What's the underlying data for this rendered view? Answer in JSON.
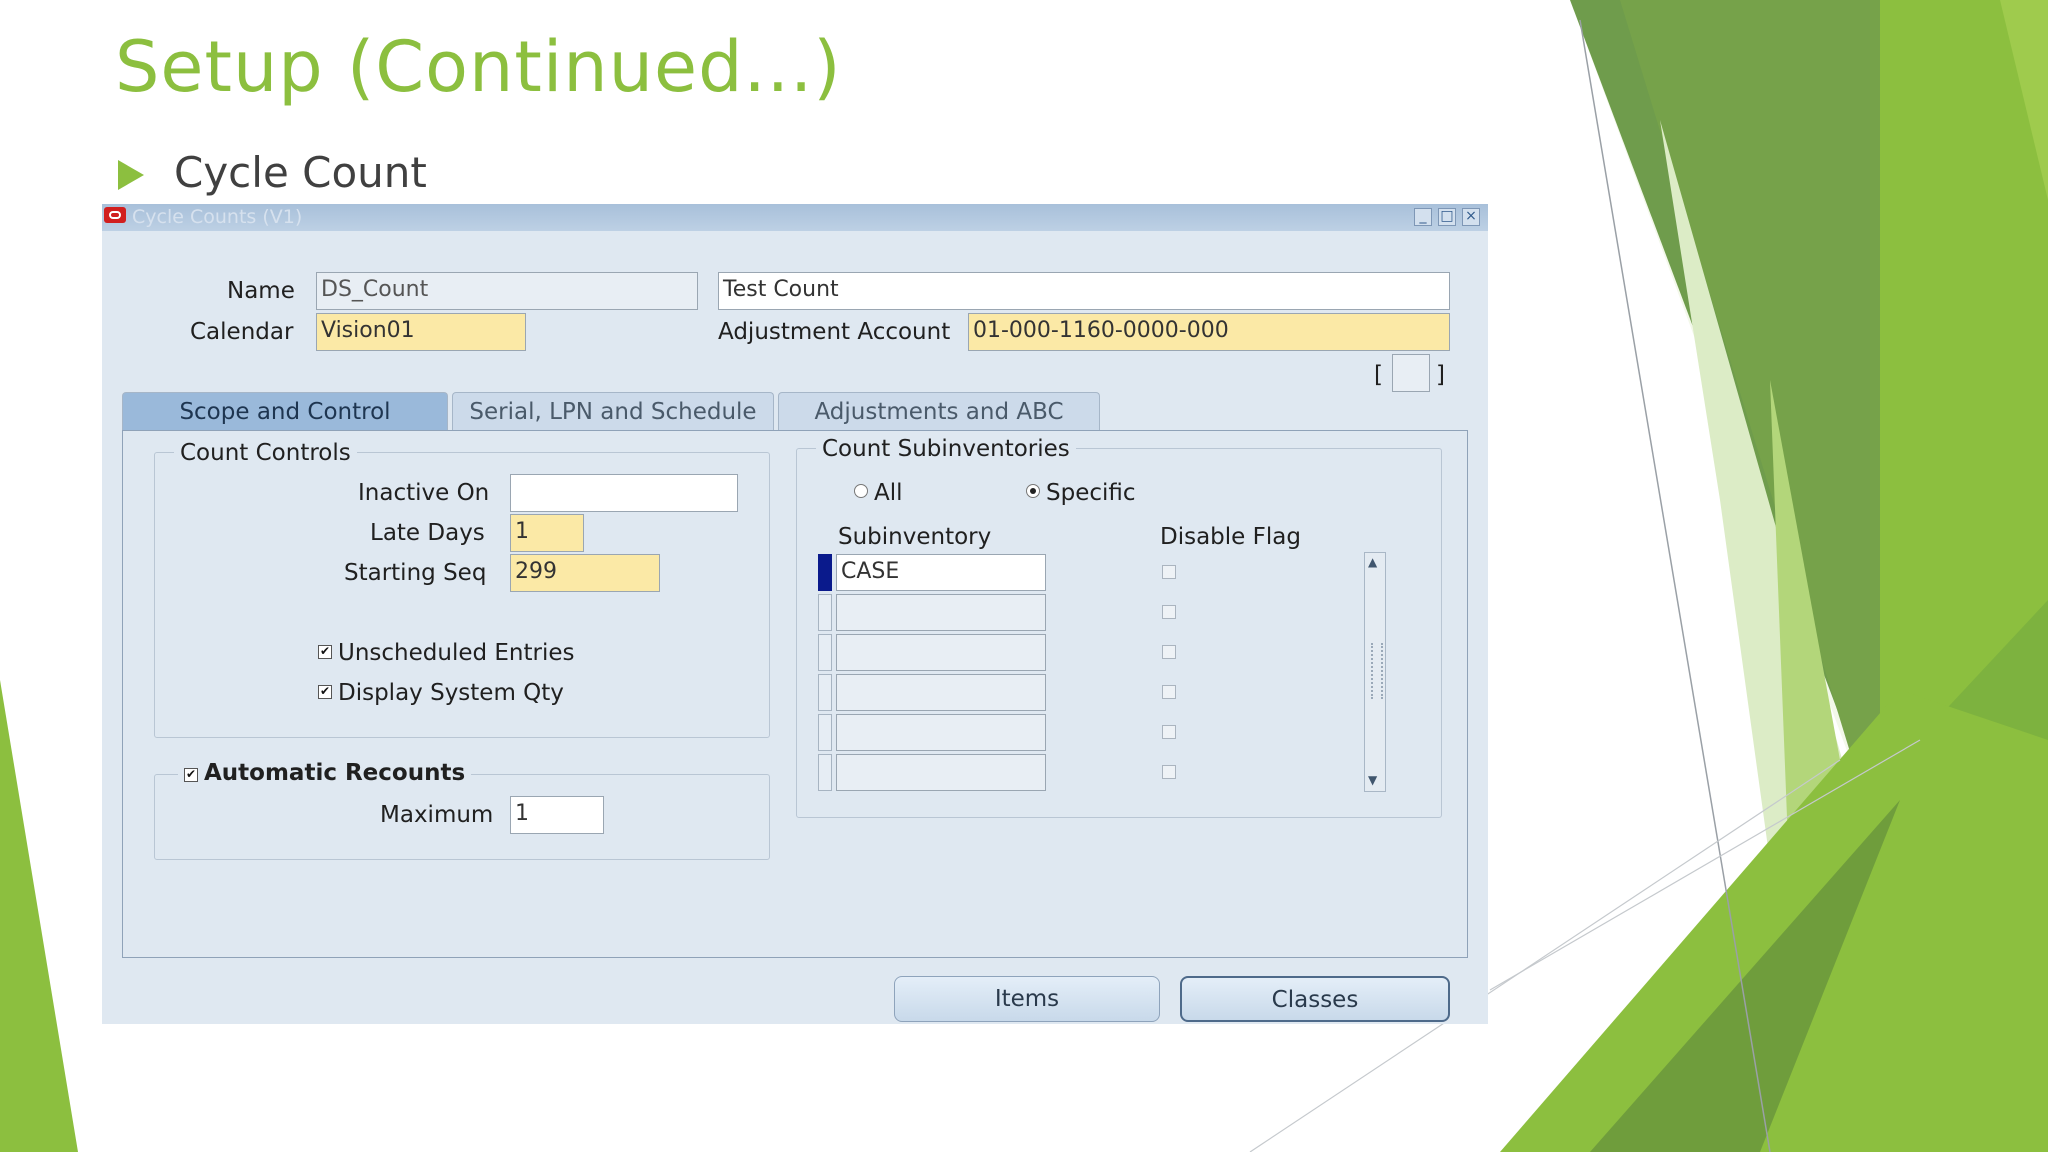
{
  "slide": {
    "title": "Setup (Continued...)",
    "bullet": "Cycle Count"
  },
  "colors": {
    "accent_green": "#8cbf3f",
    "window_bg": "#dfe8f1",
    "required_field": "#fbe9a6"
  },
  "window": {
    "title": "Cycle Counts (V1)",
    "icons": [
      "oracle-logo-icon",
      "minimize-icon",
      "maximize-icon",
      "close-icon"
    ],
    "header": {
      "name_label": "Name",
      "name_value": "DS_Count",
      "description_value": "Test Count",
      "calendar_label": "Calendar",
      "calendar_value": "Vision01",
      "adjustment_account_label": "Adjustment Account",
      "adjustment_account_value": "01-000-1160-0000-000",
      "context_field_open": "[",
      "context_field_close": "]"
    },
    "tabs": [
      {
        "label": "Scope and Control",
        "active": true
      },
      {
        "label": "Serial, LPN and Schedule",
        "active": false
      },
      {
        "label": "Adjustments and ABC",
        "active": false
      }
    ],
    "count_controls": {
      "title": "Count Controls",
      "inactive_on_label": "Inactive On",
      "inactive_on_value": "",
      "late_days_label": "Late Days",
      "late_days_value": "1",
      "starting_seq_label": "Starting Seq",
      "starting_seq_value": "299",
      "unscheduled_entries_label": "Unscheduled Entries",
      "unscheduled_entries_checked": true,
      "display_system_qty_label": "Display System Qty",
      "display_system_qty_checked": true
    },
    "automatic_recounts": {
      "label": "Automatic Recounts",
      "checked": true,
      "maximum_label": "Maximum",
      "maximum_value": "1"
    },
    "count_subinventories": {
      "title": "Count Subinventories",
      "radio_all_label": "All",
      "radio_specific_label": "Specific",
      "selected": "Specific",
      "col_subinventory": "Subinventory",
      "col_disable_flag": "Disable Flag",
      "rows": [
        {
          "subinventory": "CASE",
          "disable_flag": false
        },
        {
          "subinventory": "",
          "disable_flag": false
        },
        {
          "subinventory": "",
          "disable_flag": false
        },
        {
          "subinventory": "",
          "disable_flag": false
        },
        {
          "subinventory": "",
          "disable_flag": false
        },
        {
          "subinventory": "",
          "disable_flag": false
        }
      ]
    },
    "buttons": {
      "items": "Items",
      "classes": "Classes"
    }
  }
}
